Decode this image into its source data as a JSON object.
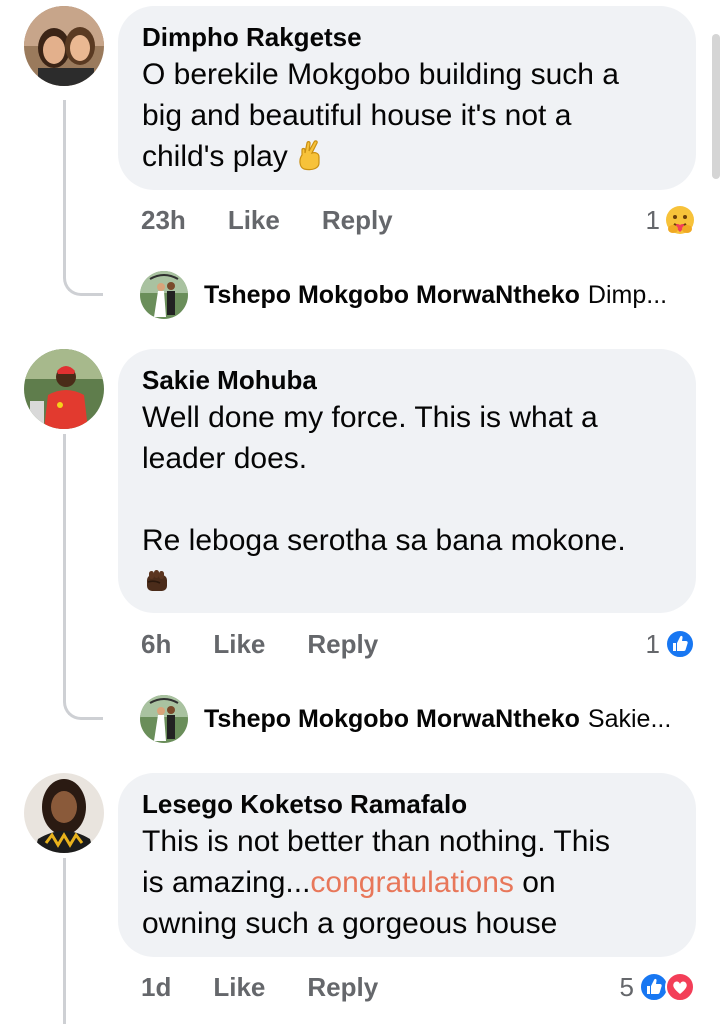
{
  "comments": [
    {
      "author": "Dimpho Rakgetse",
      "lines": [
        "O berekile Mokgobo building such a",
        "big and beautiful house it's not a",
        "child's play"
      ],
      "time": "23h",
      "like_label": "Like",
      "reply_label": "Reply",
      "reaction_count": "1",
      "reaction_icons": [
        "care-reaction-icon"
      ],
      "reply_preview": {
        "author": "Tshepo Mokgobo MorwaNtheko",
        "snippet": "Dimp..."
      }
    },
    {
      "author": "Sakie Mohuba",
      "lines": [
        "Well done my force. This is what a",
        "leader does.",
        "",
        "Re leboga serotha sa bana mokone."
      ],
      "time": "6h",
      "like_label": "Like",
      "reply_label": "Reply",
      "reaction_count": "1",
      "reaction_icons": [
        "like-reaction-icon"
      ],
      "reply_preview": {
        "author": "Tshepo Mokgobo MorwaNtheko",
        "snippet": "Sakie..."
      }
    },
    {
      "author": "Lesego Koketso Ramafalo",
      "line1": "This is not better than nothing. This",
      "line2_prefix": "is amazing...",
      "line2_link": "congratulations",
      "line2_suffix": " on",
      "line3": "owning such a gorgeous house",
      "time": "1d",
      "like_label": "Like",
      "reply_label": "Reply",
      "reaction_count": "5",
      "reaction_icons": [
        "like-reaction-icon",
        "love-reaction-icon"
      ]
    }
  ],
  "colors": {
    "bubble": "#f0f2f5",
    "meta_text": "#65676b",
    "link": "#e8775a",
    "like_blue": "#1877f2",
    "love_red": "#f33e58"
  }
}
